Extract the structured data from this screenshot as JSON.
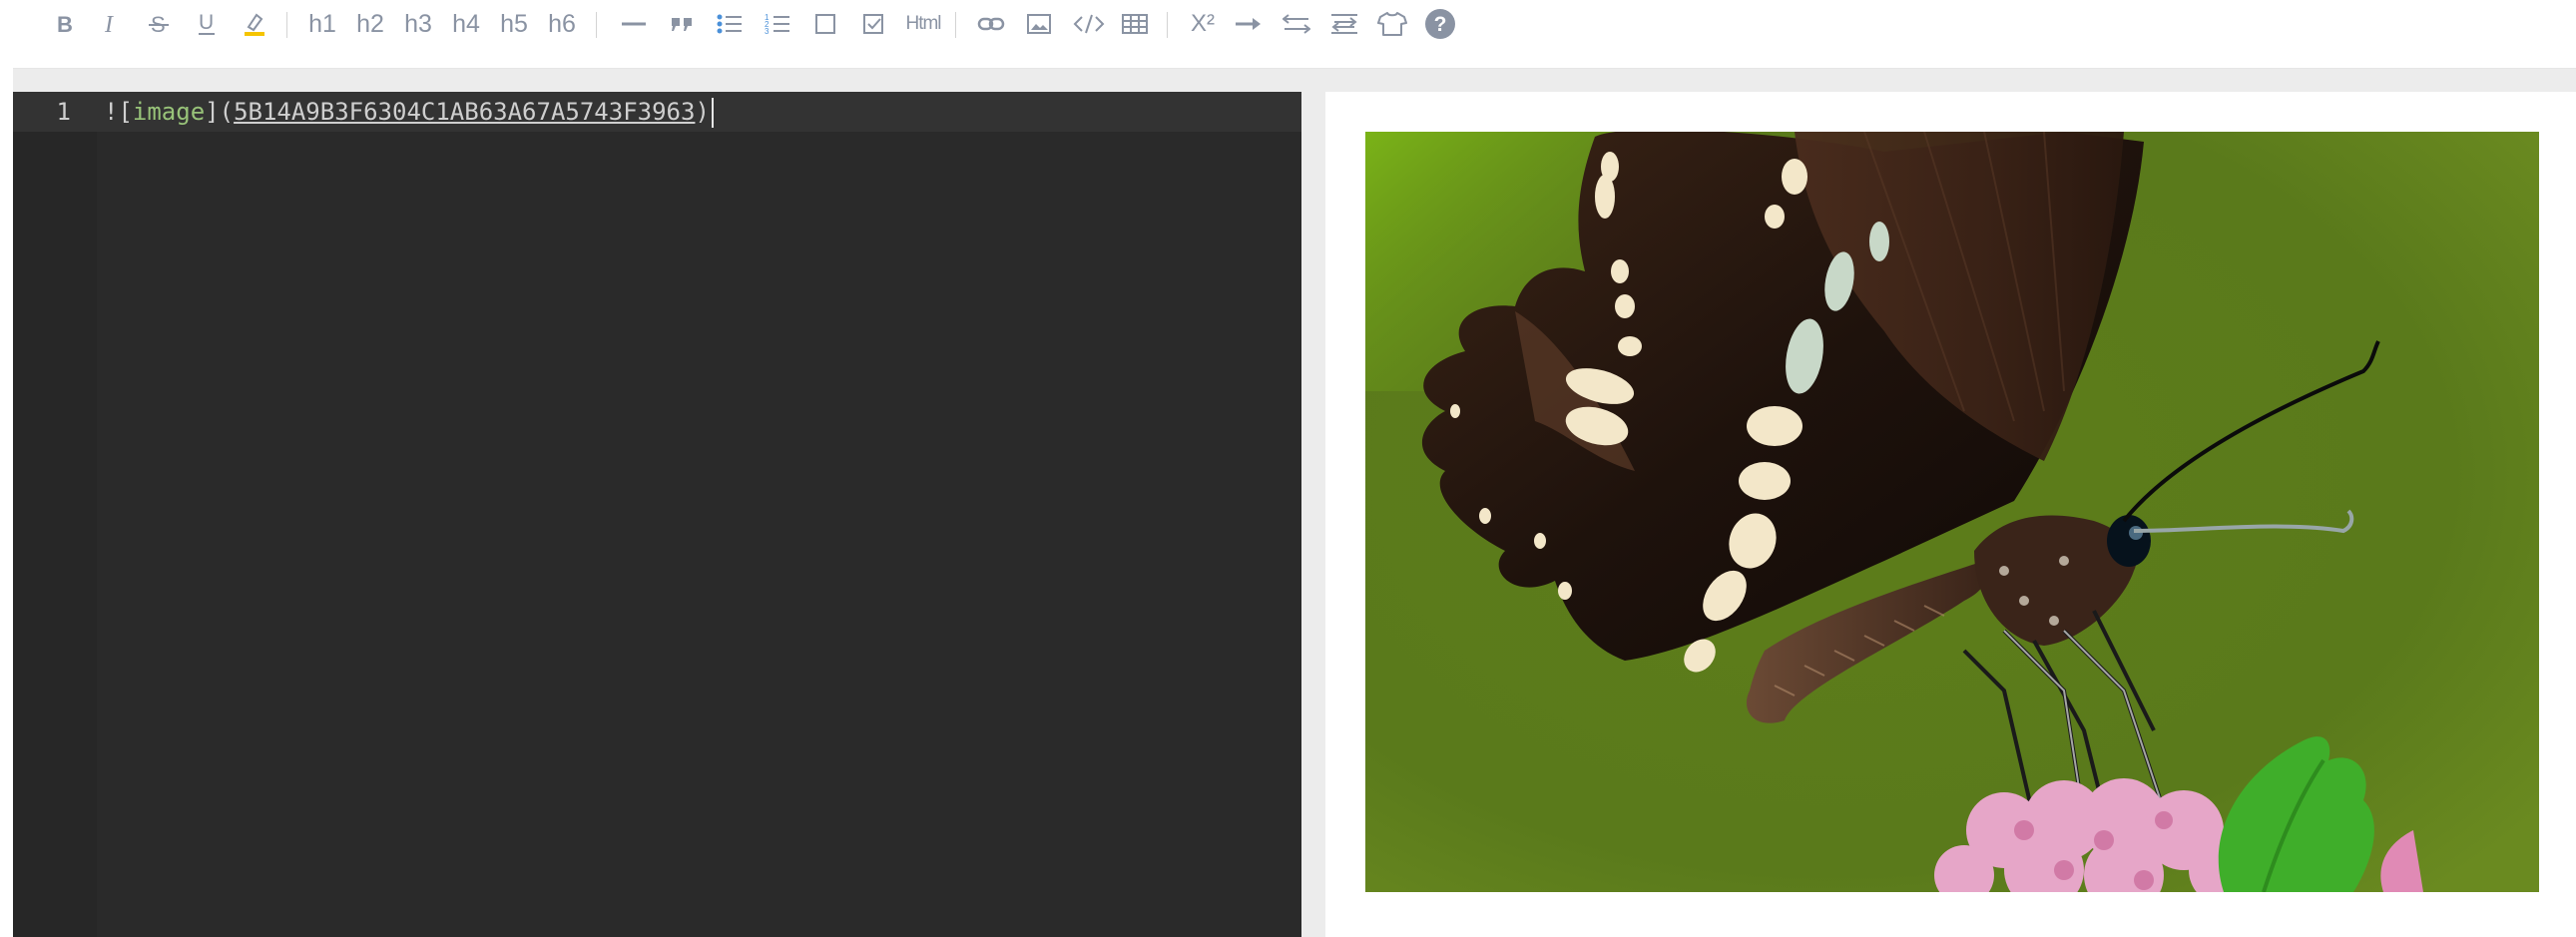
{
  "toolbar": {
    "headings": [
      "h1",
      "h2",
      "h3",
      "h4",
      "h5",
      "h6"
    ],
    "html_label": "Html",
    "superscript_label": "X²",
    "icons": [
      "bold-icon",
      "italic-icon",
      "strikethrough-icon",
      "underline-icon",
      "highlight-icon",
      "horizontal-rule-icon",
      "quote-icon",
      "bullet-list-icon",
      "ordered-list-icon",
      "checkbox-unchecked-icon",
      "checkbox-checked-icon",
      "html-icon",
      "link-icon",
      "image-icon",
      "code-icon",
      "table-icon",
      "superscript-icon",
      "arrow-right-icon",
      "swap-icon",
      "align-icon",
      "theme-shirt-icon",
      "help-icon"
    ]
  },
  "editor": {
    "line_number": "1",
    "prefix": "![",
    "alt_text": "image",
    "mid": "](",
    "url": "5B14A9B3F6304C1AB63A67A5743F3963",
    "suffix": ")"
  },
  "preview": {
    "image_description": "butterfly-photo"
  },
  "colors": {
    "editor_bg": "#2a2a2a",
    "editor_active_line": "#333333",
    "toolbar_icon": "#8a93a3",
    "highlight_underline": "#f5c400",
    "link_blue": "#4a90d9"
  }
}
